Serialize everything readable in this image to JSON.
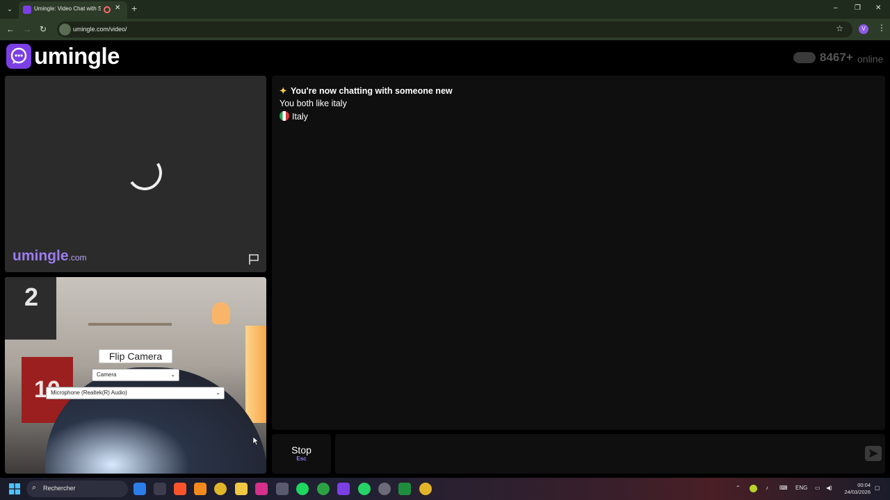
{
  "browser": {
    "tab_title": "Umingle: Video Chat with S",
    "url": "umingle.com/video/",
    "profile_initial": "V",
    "window_controls": [
      "–",
      "❐",
      "✕"
    ]
  },
  "header": {
    "logo_text": "umingle",
    "online_count": "8467+",
    "online_label": "online"
  },
  "stranger_video": {
    "watermark_name": "umingle",
    "watermark_tld": ".com"
  },
  "self_video": {
    "flip_camera_label": "Flip Camera",
    "camera_select_value": "Camera",
    "microphone_select_value": "Microphone (Realtek(R) Audio)",
    "poster1_text": "2",
    "poster2_text": "10"
  },
  "chat": {
    "messages": [
      "You're now chatting with someone new",
      "You both like italy",
      "Italy"
    ]
  },
  "controls": {
    "stop_label": "Stop",
    "stop_key": "Esc"
  },
  "taskbar": {
    "search_label": "Rechercher",
    "language": "ENG",
    "time": "00:04",
    "date": "24/03/2026"
  },
  "colors": {
    "brand_purple": "#7b3fe4",
    "chrome_green": "#2d3b29",
    "panel_bg": "#0f0f0f",
    "stop_key_color": "#8b7cf6"
  }
}
